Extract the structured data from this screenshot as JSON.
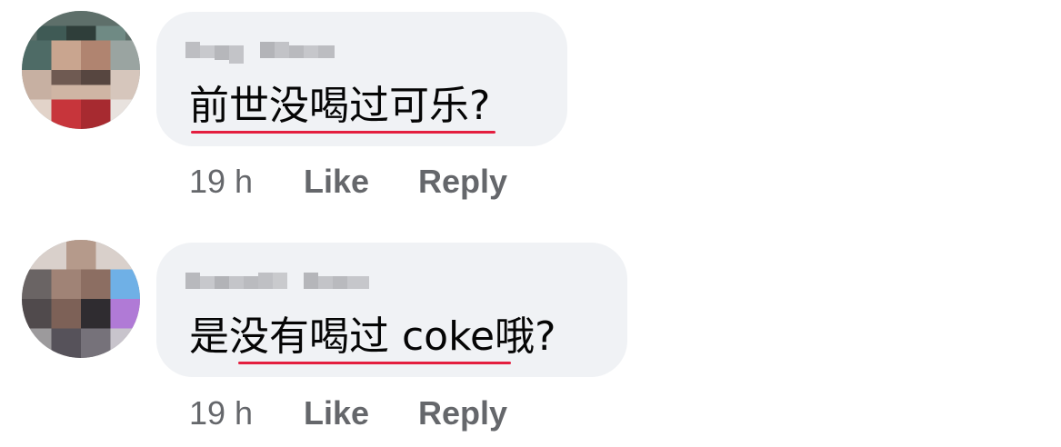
{
  "comments": [
    {
      "text_prefix": "",
      "text_underlined": "前世没喝过可乐",
      "text_suffix": "?",
      "time": "19 h",
      "like_label": "Like",
      "reply_label": "Reply"
    },
    {
      "text_prefix": "是",
      "text_underlined": "没有喝过 coke",
      "text_suffix": "哦?",
      "time": "19 h",
      "like_label": "Like",
      "reply_label": "Reply"
    }
  ],
  "colors": {
    "bubble": "#f0f2f5",
    "text": "#050505",
    "meta": "#65676b",
    "spellcheck_underline": "#e41e3f"
  }
}
